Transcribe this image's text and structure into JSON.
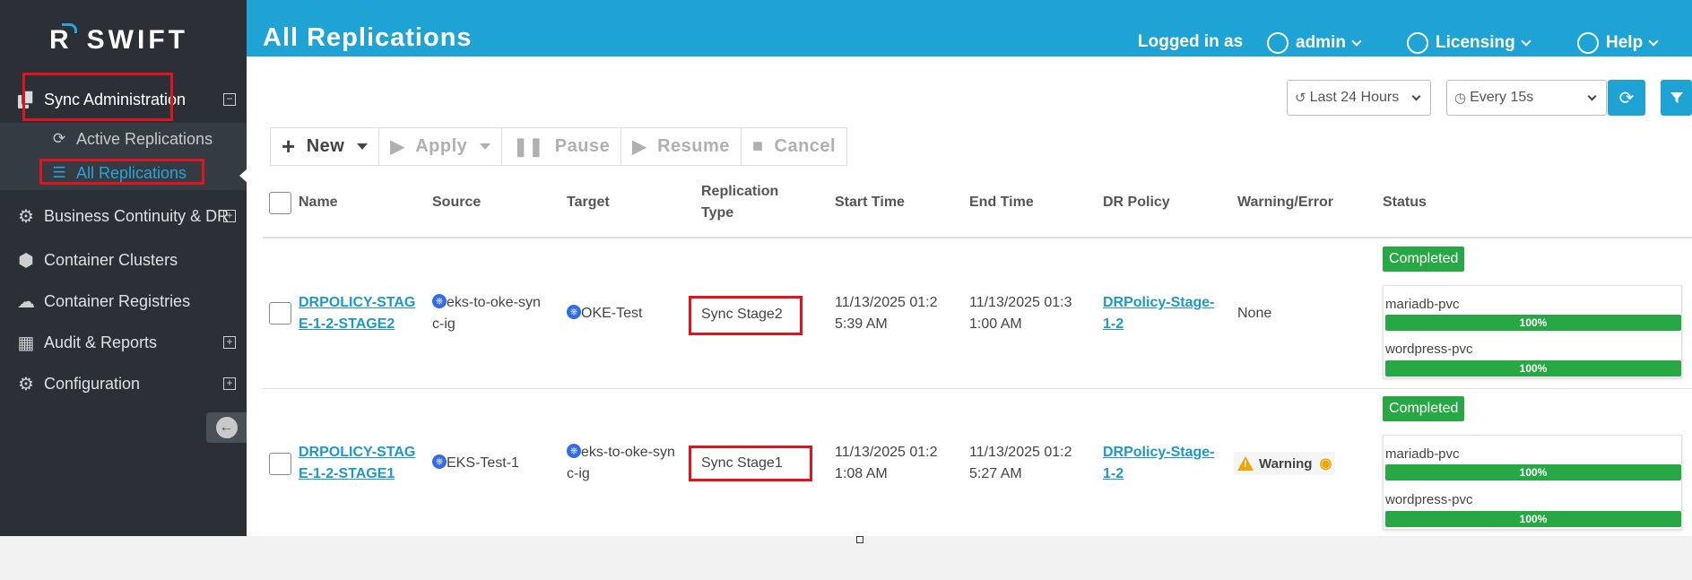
{
  "app": {
    "logo": "SWIFT",
    "logo_r": "R"
  },
  "sidebar": {
    "items": [
      {
        "label": "Sync Administration",
        "expander": "⊟"
      },
      {
        "label": "Active Replications"
      },
      {
        "label": "All Replications"
      },
      {
        "label": "Business Continuity & DR",
        "expander": "⊞"
      },
      {
        "label": "Container Clusters"
      },
      {
        "label": "Container Registries"
      },
      {
        "label": "Audit & Reports",
        "expander": "⊞"
      },
      {
        "label": "Configuration",
        "expander": "⊞"
      }
    ]
  },
  "header": {
    "title": "All Replications",
    "logged_in_as": "Logged in as",
    "user": "admin",
    "licensing": "Licensing",
    "help": "Help"
  },
  "controls": {
    "time_range": "Last 24 Hours",
    "refresh_interval": "Every 15s"
  },
  "toolbar": {
    "new": "New",
    "apply": "Apply",
    "pause": "Pause",
    "resume": "Resume",
    "cancel": "Cancel"
  },
  "table": {
    "columns": {
      "name": "Name",
      "source": "Source",
      "target": "Target",
      "replication_type_1": "Replication",
      "replication_type_2": "Type",
      "start_time": "Start Time",
      "end_time": "End Time",
      "dr_policy": "DR Policy",
      "warning": "Warning/Error",
      "status": "Status"
    },
    "rows": [
      {
        "name_1": "DRPOLICY-STAG",
        "name_2": "E-1-2-STAGE2",
        "source_1": "eks-to-oke-syn",
        "source_2": "c-ig",
        "target_1": "OKE-Test",
        "target_2": "",
        "type": "Sync Stage2",
        "start_1": "11/13/2025 01:2",
        "start_2": "5:39 AM",
        "end_1": "11/13/2025 01:3",
        "end_2": "1:00 AM",
        "policy_1": "DRPolicy-Stage-",
        "policy_2": "1-2",
        "warning": "None",
        "status": "Completed",
        "pvcs": [
          {
            "name": "mariadb-pvc",
            "progress": "100%"
          },
          {
            "name": "wordpress-pvc",
            "progress": "100%"
          }
        ]
      },
      {
        "name_1": "DRPOLICY-STAG",
        "name_2": "E-1-2-STAGE1",
        "source_1": "EKS-Test-1",
        "source_2": "",
        "target_1": "eks-to-oke-syn",
        "target_2": "c-ig",
        "type": "Sync Stage1",
        "start_1": "11/13/2025 01:2",
        "start_2": "1:08 AM",
        "end_1": "11/13/2025 01:2",
        "end_2": "5:27 AM",
        "policy_1": "DRPolicy-Stage-",
        "policy_2": "1-2",
        "warning": "Warning",
        "status": "Completed",
        "pvcs": [
          {
            "name": "mariadb-pvc",
            "progress": "100%"
          },
          {
            "name": "wordpress-pvc",
            "progress": "100%"
          }
        ]
      }
    ]
  },
  "colors": {
    "header_blue": "#1fa3d5",
    "sidebar_bg": "#2b3036",
    "completed_green": "#28a745",
    "highlight_red": "#e0141e",
    "link_blue": "#1f97c9"
  },
  "icons": [
    "refresh-icon",
    "filter-icon",
    "history-icon",
    "clock-icon",
    "user-icon",
    "licensing-icon",
    "help-icon",
    "kubernetes-icon",
    "warning-icon",
    "eye-icon",
    "collapse-sidebar-icon"
  ]
}
